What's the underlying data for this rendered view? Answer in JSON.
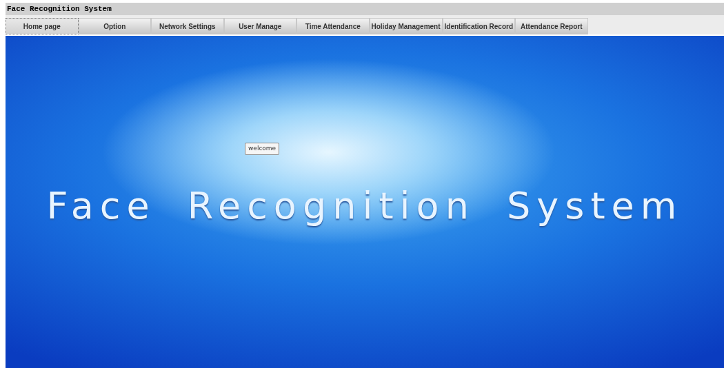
{
  "window": {
    "title": "Face Recognition System"
  },
  "tabs": [
    {
      "label": "Home page",
      "selected": true
    },
    {
      "label": "Option",
      "selected": false
    },
    {
      "label": "Network Settings",
      "selected": false
    },
    {
      "label": "User Manage",
      "selected": false
    },
    {
      "label": "Time Attendance",
      "selected": false
    },
    {
      "label": "Holiday Management",
      "selected": false
    },
    {
      "label": "Identification Record",
      "selected": false
    },
    {
      "label": "Attendance Report",
      "selected": false
    }
  ],
  "banner": {
    "tooltip": "welcome",
    "heading": "Face Recognition System"
  }
}
